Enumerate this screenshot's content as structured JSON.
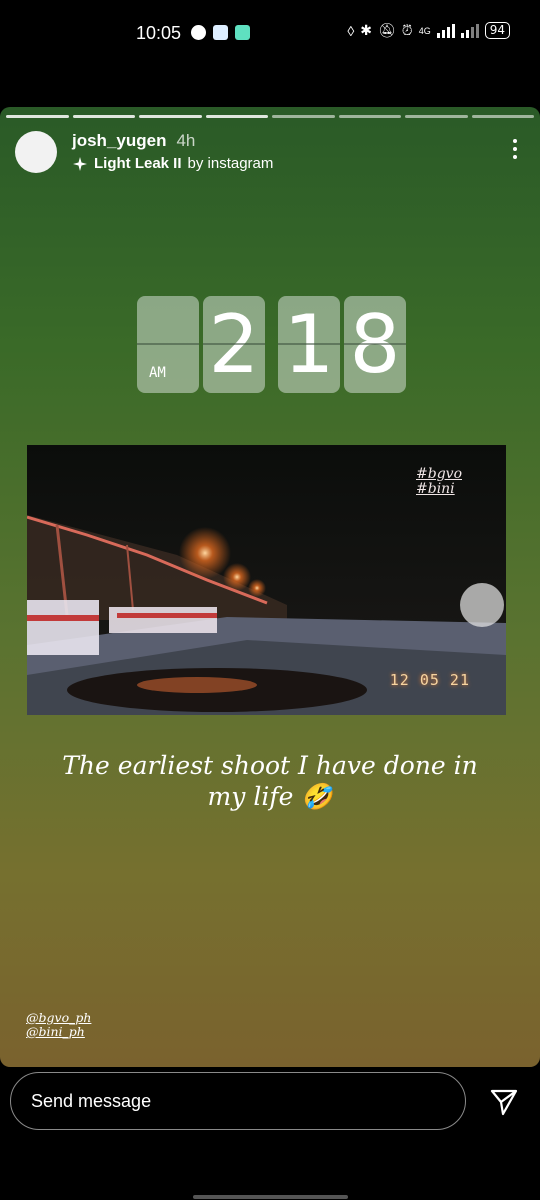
{
  "status_bar": {
    "time": "10:05",
    "network": "4G",
    "battery": "94",
    "icons": [
      "spotify-icon",
      "tv-app-icon",
      "app-icon",
      "data-saver-icon",
      "bluetooth-icon",
      "mute-icon",
      "alarm-icon",
      "wifi-icon",
      "signal-icon",
      "battery-icon"
    ]
  },
  "story": {
    "username": "josh_yugen",
    "age": "4h",
    "effect_name": "Light Leak II",
    "effect_by": "by instagram",
    "segments_total": 8,
    "segments_viewed": 4,
    "clock": {
      "ampm": "AM",
      "h1": "",
      "h2": "2",
      "m1": "1",
      "m2": "8"
    },
    "photo": {
      "tags": [
        "#bgvo",
        "#bini"
      ],
      "date_stamp": "12 05 21"
    },
    "caption": "The earliest shoot I have done in my life 🤣",
    "bottom_tags": [
      "@bgvo_ph",
      "@bini_ph"
    ]
  },
  "reply": {
    "placeholder": "Send message"
  },
  "colors": {
    "story_top": "#2a5a27",
    "story_bottom": "#7a622e",
    "date_stamp": "#f7d4a0"
  }
}
